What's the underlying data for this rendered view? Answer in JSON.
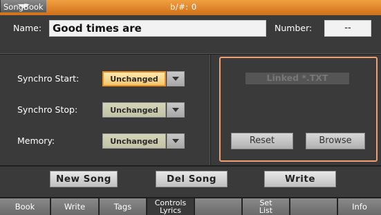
{
  "titlebar": {
    "app": "SongBook",
    "key_label": "b/#: 0",
    "menu_icon": "triangle-down-icon"
  },
  "name": {
    "label": "Name:",
    "value": "Good times are"
  },
  "number": {
    "label": "Number:",
    "value": "--"
  },
  "settings": [
    {
      "label": "Synchro Start:",
      "value": "Unchanged"
    },
    {
      "label": "Synchro Stop:",
      "value": "Unchanged"
    },
    {
      "label": "Memory:",
      "value": "Unchanged"
    }
  ],
  "linked": {
    "label": "Linked *.TXT",
    "reset": "Reset",
    "browse": "Browse"
  },
  "actions": {
    "new_song": "New Song",
    "del_song": "Del Song",
    "write": "Write"
  },
  "tabs": [
    {
      "label": "Book"
    },
    {
      "label": "Write"
    },
    {
      "label": "Tags"
    },
    {
      "line1": "Controls",
      "line2": "Lyrics"
    },
    {
      "label": ""
    },
    {
      "line1": "Set",
      "line2": "List"
    },
    {
      "label": ""
    },
    {
      "label": "Info"
    }
  ],
  "colors": {
    "accent": "#e08a2c",
    "highlight_border": "#f0a070"
  }
}
